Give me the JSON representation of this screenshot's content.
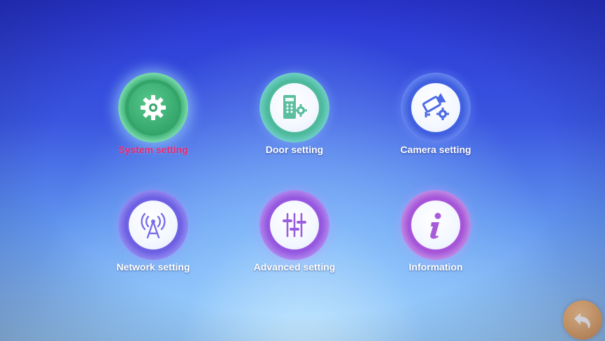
{
  "menu": {
    "items": [
      {
        "label": "System setting",
        "icon": "gear-icon",
        "selected": true
      },
      {
        "label": "Door setting",
        "icon": "door-gear-icon",
        "selected": false
      },
      {
        "label": "Camera setting",
        "icon": "camera-gear-icon",
        "selected": false
      },
      {
        "label": "Network setting",
        "icon": "antenna-icon",
        "selected": false
      },
      {
        "label": "Advanced setting",
        "icon": "sliders-icon",
        "selected": false
      },
      {
        "label": "Information",
        "icon": "info-icon",
        "selected": false
      }
    ]
  },
  "back": {
    "icon": "back-arrow-icon"
  },
  "colors": {
    "selected_label": "#e8276f",
    "label": "#ffffff",
    "background_top": "#2a36d4",
    "background_bottom": "#9fd0f7",
    "back_button": "#e7a766"
  }
}
